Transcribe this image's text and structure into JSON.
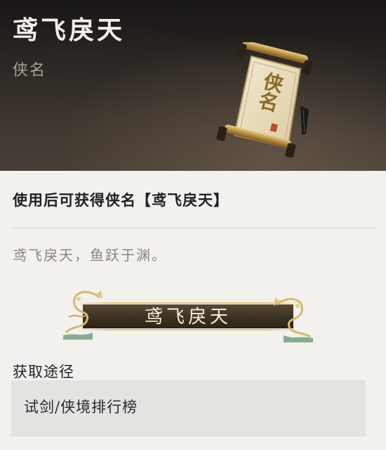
{
  "header": {
    "title": "鸢飞戾天",
    "type": "侠名",
    "scroll_text": "侠名"
  },
  "description": {
    "obtain_text": "使用后可获得侠名【鸢飞戾天】",
    "flavor_text": "鸢飞戾天，鱼跃于渊。"
  },
  "banner": {
    "name": "鸢飞戾天"
  },
  "source": {
    "heading": "获取途径",
    "value": "试剑/侠境排行榜"
  },
  "colors": {
    "header_dark": "#1a1816",
    "gold": "#c9a55c",
    "banner_bg": "#3e3424",
    "panel_bg": "#f2f1ee",
    "source_bg": "#e4e3e0"
  },
  "icons": [
    "scroll-icon",
    "dragon-ornament-left-icon",
    "dragon-ornament-right-icon"
  ]
}
